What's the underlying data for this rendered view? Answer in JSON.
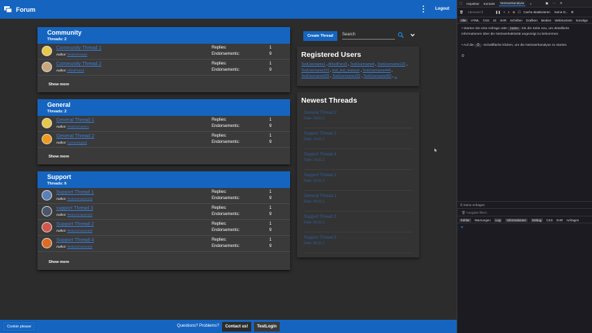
{
  "header": {
    "title": "Forum",
    "logout_label": "Logout"
  },
  "colors": {
    "primary": "#1565c0",
    "link": "#3d7ed8",
    "background": "#2c2c2c"
  },
  "sections": [
    {
      "title": "Community",
      "count": "Threads: 2",
      "show_more": "Show more",
      "threads": [
        {
          "title": "Community Thread 1",
          "author": "TestUsername",
          "replies": "1",
          "endorsements": "9",
          "avatar": "avatar-yellow"
        },
        {
          "title": "Community Thread 2",
          "author": "AlfredPan15",
          "replies": "1",
          "endorsements": "9",
          "avatar": "avatar-face"
        }
      ]
    },
    {
      "title": "General",
      "count": "Threads: 2",
      "show_more": "Show more",
      "threads": [
        {
          "title": "General Thread 1",
          "author": "TestUsername1",
          "replies": "1",
          "endorsements": "9",
          "avatar": "avatar-yellow"
        },
        {
          "title": "General Thread 2",
          "author": "Cyclonesquad",
          "replies": "1",
          "endorsements": "9",
          "avatar": "avatar-orange"
        }
      ]
    },
    {
      "title": "Support",
      "count": "Threads: 6",
      "show_more": "Show more",
      "threads": [
        {
          "title": "Support Thread 1",
          "author": "TestUsername123",
          "replies": "1",
          "endorsements": "9",
          "avatar": "avatar-blue"
        },
        {
          "title": "support Thread 3",
          "author": "TestUsername101",
          "replies": "1",
          "endorsements": "9",
          "avatar": "avatar-dark"
        },
        {
          "title": "Support Thread 2",
          "author": "TestUsername460",
          "replies": "1",
          "endorsements": "9",
          "avatar": "avatar-red"
        },
        {
          "title": "Support Thread 4",
          "author": "TestUsername444",
          "replies": "1",
          "endorsements": "9",
          "avatar": "avatar-fire"
        }
      ]
    }
  ],
  "labels": {
    "replies": "Replies:",
    "endorsements": "Endorsements:",
    "author": "Author:"
  },
  "sidebar": {
    "create_thread": "Create Thread",
    "search_placeholder": "Search",
    "registered_users_title": "Registered Users",
    "users": [
      "TestUsername1",
      "AlfredPan15",
      "TestUsername4",
      "TestUsername123",
      "TestUsername101",
      "test_test_testuser",
      "TestUsername444",
      "TestUsername555",
      "TestUsername333",
      "TestUsername460",
      "..."
    ],
    "newest_threads_title": "Newest Threads",
    "newest_threads": [
      {
        "title": "General Thread 2",
        "date": "Date: 14.01.1"
      },
      {
        "title": "Support Thread 2",
        "date": "Date: 14.01.1"
      },
      {
        "title": "Support Thread 4",
        "date": "Date: 14.01.1"
      },
      {
        "title": "Support Thread 1",
        "date": "Date: 12.01.1"
      },
      {
        "title": "General Thread 1",
        "date": "Date: 06.01.1"
      },
      {
        "title": "Support Thread 3",
        "date": "Date: 06.01.1"
      },
      {
        "title": "Support Thread 5",
        "date": "Date: 06.01.1"
      }
    ]
  },
  "footer": {
    "cookie": "Cookie please",
    "questions": "Questions? Problems?",
    "contact": "Contact us!",
    "login": "TestLogin"
  },
  "devtools": {
    "tabs": [
      "Inspektor",
      "Konsole",
      "Netzwerkanalyse"
    ],
    "filter_placeholder": "Adressen fi",
    "cache_label": "Cache deaktivieren",
    "throttle": "Keine D...",
    "types": [
      "Alle",
      "HTML",
      "CSS",
      "JS",
      "XHR",
      "Schriften",
      "Grafiken",
      "Medien",
      "WebSockets",
      "Sonstige"
    ],
    "msg1_a": "Starten Sie eine Anfrage oder",
    "msg1_key": "laden",
    "msg1_b": "Sie die Seite neu, um detaillierte Informationen über die Netzwerkaktivität angezeigt zu bekommen.",
    "msg2_a": "Auf die",
    "msg2_b": "-Schaltfläche klicken, um die Netzwerkanalyse zu starten.",
    "status": "Keine Anfragen",
    "console_filter": "Ausgabe filtern",
    "console_types": [
      "Fehler",
      "Warnungen",
      "Log",
      "Informationen",
      "Debug",
      "CSS",
      "XHR",
      "Anfragen"
    ],
    "prompt": "»"
  }
}
